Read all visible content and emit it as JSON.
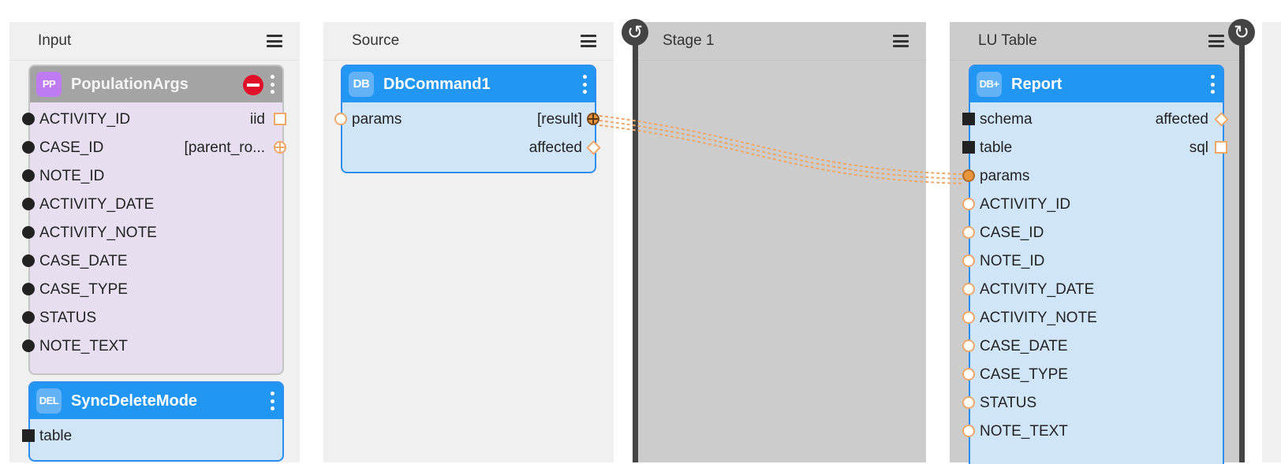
{
  "stages": {
    "input": {
      "title": "Input"
    },
    "source": {
      "title": "Source"
    },
    "stage1": {
      "title": "Stage 1"
    },
    "lu": {
      "title": "LU Table"
    }
  },
  "nodes": {
    "population": {
      "badge": "PP",
      "name": "PopulationArgs",
      "inputs": [
        "ACTIVITY_ID",
        "CASE_ID",
        "NOTE_ID",
        "ACTIVITY_DATE",
        "ACTIVITY_NOTE",
        "CASE_DATE",
        "CASE_TYPE",
        "STATUS",
        "NOTE_TEXT"
      ],
      "outputs": [
        "iid",
        "[parent_ro..."
      ]
    },
    "syncdelete": {
      "badge": "DEL",
      "name": "SyncDeleteMode",
      "inputs": [
        "table"
      ]
    },
    "dbcommand": {
      "badge": "DB",
      "name": "DbCommand1",
      "inputs": [
        "params"
      ],
      "outputs": [
        "[result]",
        "affected"
      ]
    },
    "report": {
      "badge": "DB+",
      "name": "Report",
      "inputs": [
        "schema",
        "table",
        "params",
        "ACTIVITY_ID",
        "CASE_ID",
        "NOTE_ID",
        "ACTIVITY_DATE",
        "ACTIVITY_NOTE",
        "CASE_DATE",
        "CASE_TYPE",
        "STATUS",
        "NOTE_TEXT"
      ],
      "outputs": [
        "affected",
        "sql"
      ]
    }
  },
  "colors": {
    "node_blue": "#2196f3",
    "node_body_blue": "#d0e5f8",
    "node_purple": "#e7dff0",
    "port_orange": "#f0a869",
    "link_orange": "#f0a869",
    "stage_dark": "#cccccc",
    "stage_light": "#f0f0f0"
  },
  "icons": [
    "menu-icon",
    "kebab-icon",
    "stop-icon",
    "rotate-left-icon",
    "rotate-right-icon"
  ]
}
